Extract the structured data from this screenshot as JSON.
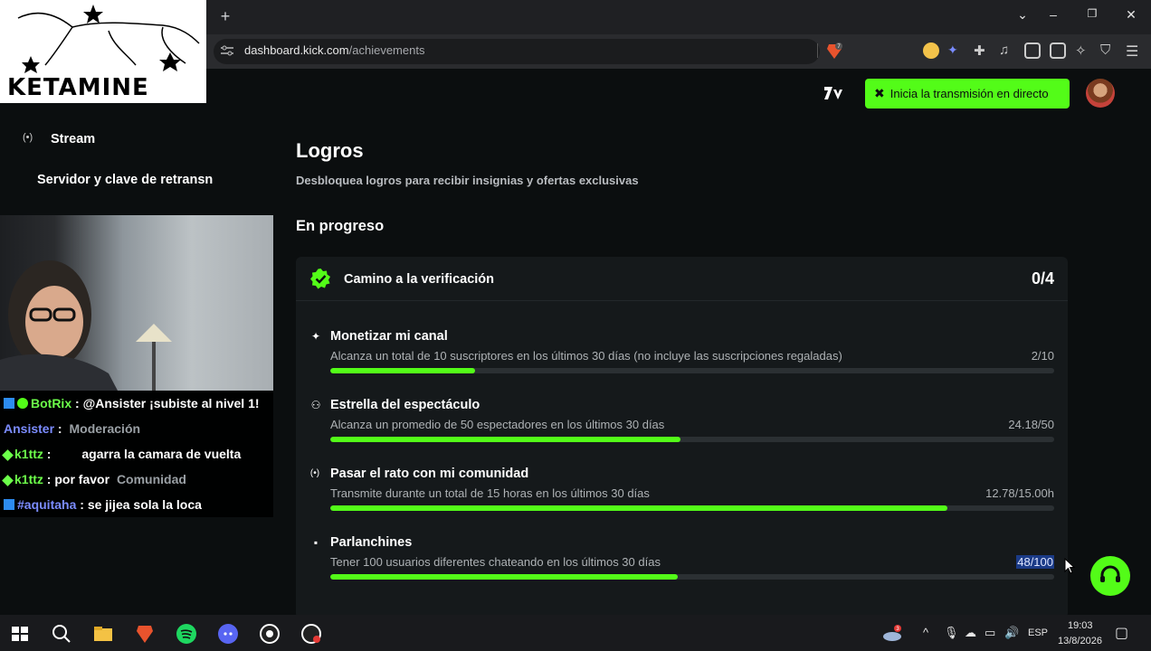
{
  "browser": {
    "new_tab": "+",
    "url_domain": "dashboard.kick.com",
    "url_path": "/achievements",
    "brave_count": "7",
    "window_controls": {
      "dropdown": "⌄",
      "minimize": "–",
      "restore": "❐",
      "close": "✕"
    }
  },
  "header": {
    "go_live_label": "Inicia la transmisión en directo"
  },
  "sidebar": {
    "stream_label": "Stream",
    "server_key_label": "Servidor y clave de retransn",
    "moderation_label": "Moderación",
    "community_label": "Comunidad"
  },
  "main": {
    "title": "Logros",
    "subtitle": "Desbloquea logros para recibir insignias y ofertas exclusivas",
    "section_title": "En progreso",
    "card": {
      "title": "Camino a la verificación",
      "count": "0/4",
      "achievements": [
        {
          "icon": "sparkle-icon",
          "title": "Monetizar mi canal",
          "description": "Alcanza un total de 10 suscriptores en los últimos 30 días (no incluye las suscripciones regaladas)",
          "value": "2/10",
          "progress": 0.2
        },
        {
          "icon": "audience-icon",
          "title": "Estrella del espectáculo",
          "description": "Alcanza un promedio de 50 espectadores en los últimos 30 días",
          "value": "24.18/50",
          "progress": 0.4836
        },
        {
          "icon": "broadcast-icon",
          "title": "Pasar el rato con mi comunidad",
          "description": "Transmite durante un total de 15 horas en los últimos 30 días",
          "value": "12.78/15.00h",
          "progress": 0.852
        },
        {
          "icon": "chat-icon",
          "title": "Parlanchines",
          "description": "Tener 100 usuarios diferentes chateando en los últimos 30 días",
          "value": "48/100",
          "progress": 0.48
        }
      ]
    }
  },
  "overlay": {
    "logo_text": "KETAMINE",
    "chat": [
      {
        "user": "BotRix",
        "sep": " : ",
        "text": "@Ansister ¡subiste al nivel 1!"
      },
      {
        "user": "Ansister",
        "sep": " : ",
        "text": ""
      },
      {
        "user": "k1ttz",
        "sep": " : ",
        "text": "agarra la camara de vuelta"
      },
      {
        "user": "k1ttz",
        "sep": " : ",
        "text": "por favor"
      },
      {
        "user": "#aquitaha",
        "sep": " : ",
        "text": "se jijea sola la loca"
      }
    ]
  },
  "taskbar": {
    "time": "19:03",
    "date": "13/8/2026",
    "language": "ESP",
    "weather_badge": "3"
  },
  "colors": {
    "accent": "#53fc18",
    "background": "#0b0e0f",
    "card": "#15191b"
  }
}
